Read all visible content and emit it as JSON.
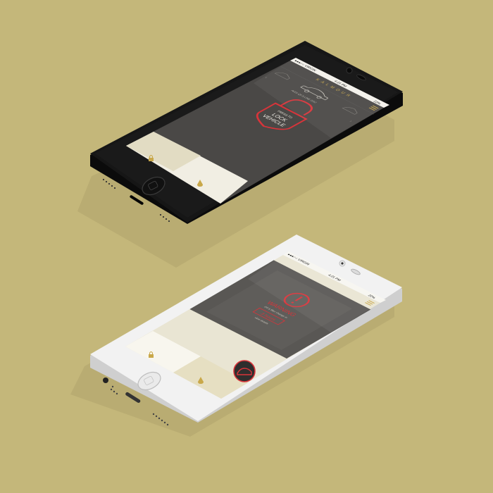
{
  "colors": {
    "background": "#c4b77a",
    "shadow": "#a99e67",
    "accent_red": "#d8343a",
    "accent_gold": "#c9a84a",
    "screen_dark": "#4a4846",
    "tabbar_light": "#e8e3cf",
    "black_body": "#161616",
    "white_body": "#f2f2f2"
  },
  "phone_black": {
    "status_bar": {
      "carrier": "●●●○○ VIRGIN",
      "time": "4:21 PM",
      "battery": "22%"
    },
    "header": {
      "brand": "KALMOUR",
      "menu_icon": "menu-icon"
    },
    "selected_vehicle_label": "AUDI Q5 S-LINE 2012",
    "lock_prompt": {
      "line1": "PRESS TO",
      "line2": "LOCK",
      "line3": "VEHICLE"
    },
    "tab_bar": {
      "left_icon": "lock-icon",
      "right_icon": "drop-icon"
    }
  },
  "phone_white": {
    "status_bar": {
      "carrier": "●●●○○ VIRGIN",
      "time": "4:21 PM",
      "battery": "22%"
    },
    "header": {
      "menu_icon": "menu-icon"
    },
    "warning": {
      "title": "WARNING",
      "subtitle": "Oil & filter change in",
      "badge": "3 hours",
      "link": "view details"
    },
    "tab_bar": {
      "left_icon": "lock-icon",
      "right_icon": "drop-icon",
      "fab_icon": "car-icon"
    }
  }
}
